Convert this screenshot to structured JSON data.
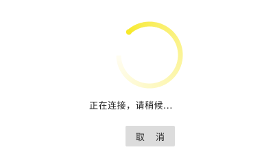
{
  "dialog": {
    "status_text": "正在连接，请稍候...",
    "cancel_label": "取 消"
  },
  "spinner": {
    "icon": "loading-spinner-icon",
    "head_color": "#f7e92a",
    "tail_color": "#fffdf2"
  },
  "colors": {
    "background": "#ffffff",
    "button_background": "#dcdcdc",
    "text": "#222222"
  }
}
